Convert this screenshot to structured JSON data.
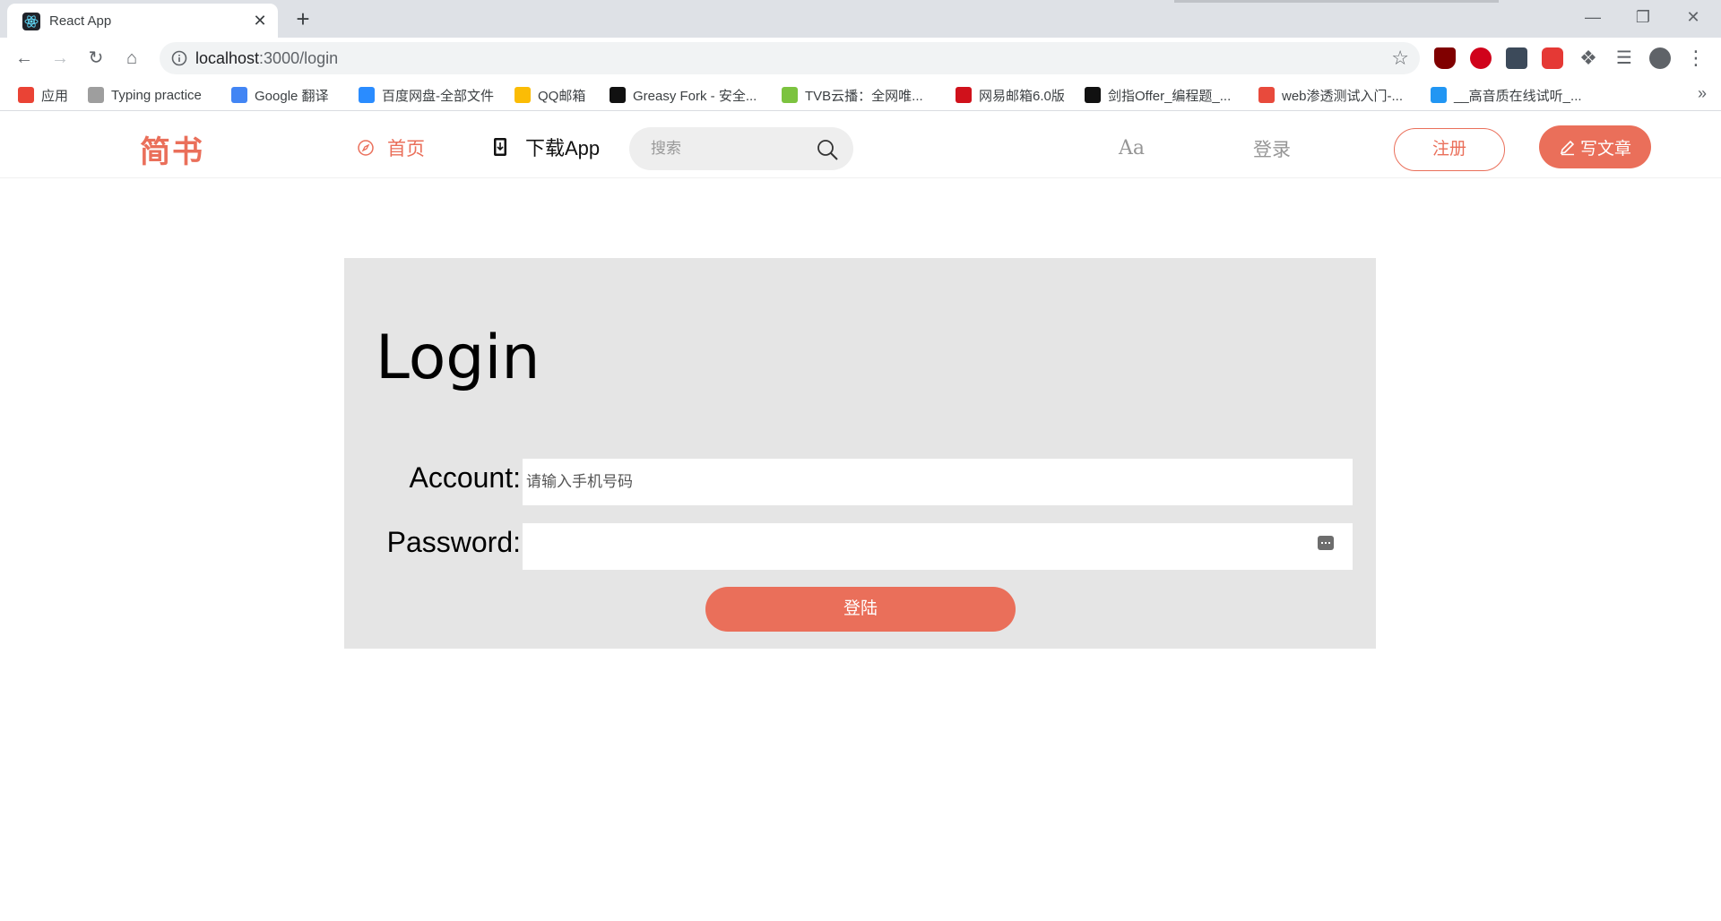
{
  "browser": {
    "tab_title": "React App",
    "tab_close": "✕",
    "new_tab": "+",
    "url_host": "localhost",
    "url_rest": ":3000/login",
    "bookmarks": [
      {
        "label": "应用",
        "color": "#ea4335"
      },
      {
        "label": "Typing practice",
        "color": "#9e9e9e"
      },
      {
        "label": "Google 翻译",
        "color": "#4285f4"
      },
      {
        "label": "百度网盘-全部文件",
        "color": "#2a8cff"
      },
      {
        "label": "QQ邮箱",
        "color": "#fbbc05"
      },
      {
        "label": "Greasy Fork - 安全...",
        "color": "#111111"
      },
      {
        "label": "TVB云播：全网唯...",
        "color": "#7cc33f"
      },
      {
        "label": "网易邮箱6.0版",
        "color": "#d0111b"
      },
      {
        "label": "剑指Offer_编程题_...",
        "color": "#111111"
      },
      {
        "label": "web渗透测试入门-...",
        "color": "#e84a3c"
      },
      {
        "label": "__高音质在线试听_...",
        "color": "#2196f3"
      }
    ],
    "bookmarks_more": "»"
  },
  "header": {
    "logo": "简书",
    "nav_home": "首页",
    "nav_download": "下载App",
    "search_placeholder": "搜索",
    "aa": "Aa",
    "login": "登录",
    "register": "注册",
    "write": "写文章",
    "accent_color": "#ea6f5a"
  },
  "login": {
    "title": "Login",
    "account_label": "Account:",
    "account_placeholder": "请输入手机号码",
    "password_label": "Password:",
    "submit": "登陆"
  }
}
